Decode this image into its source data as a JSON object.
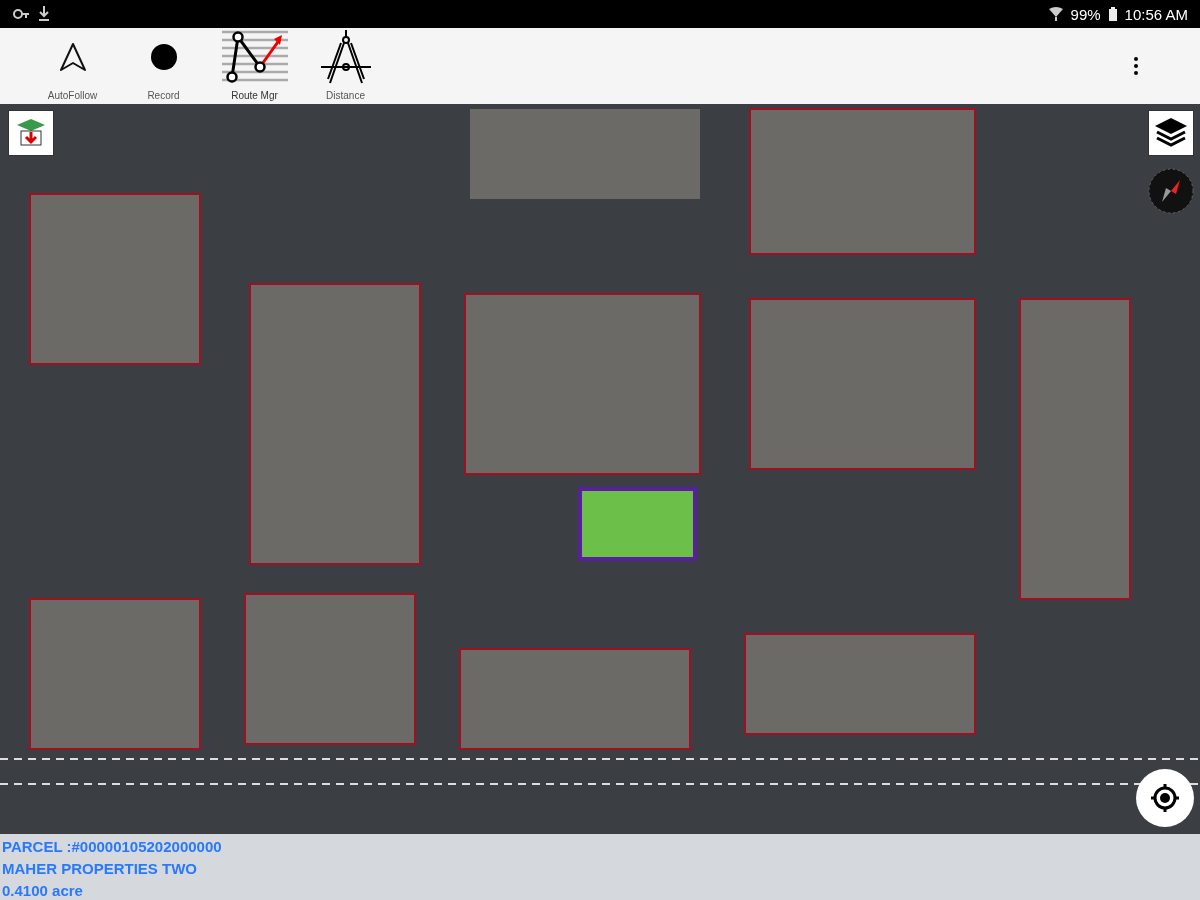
{
  "status_bar": {
    "battery": "99%",
    "time": "10:56 AM"
  },
  "toolbar": {
    "tools": [
      {
        "kind": "autofollow",
        "label": "AutoFollow",
        "selected": false
      },
      {
        "kind": "record",
        "label": "Record",
        "selected": false
      },
      {
        "kind": "route",
        "label": "Route Mgr",
        "selected": true
      },
      {
        "kind": "distance",
        "label": "Distance",
        "selected": false
      }
    ]
  },
  "parcel_info": {
    "parcel": "PARCEL :#00000105202000000",
    "owner": "MAHER PROPERTIES TWO",
    "area": "0.4100 acre"
  }
}
